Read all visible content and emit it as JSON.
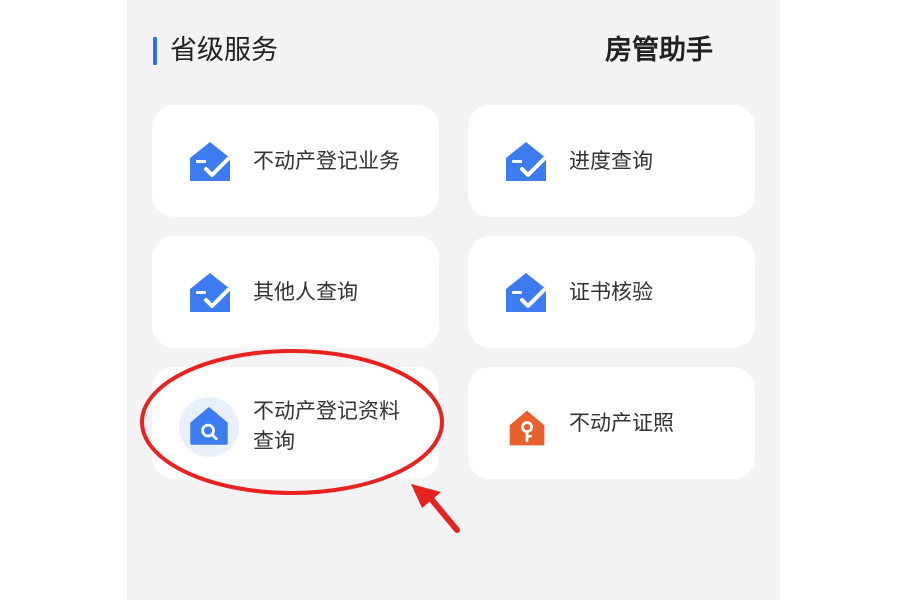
{
  "section": {
    "title": "省级服务",
    "helper": "房管助手"
  },
  "cards": [
    {
      "label": "不动产登记业务",
      "icon": "house-check-icon"
    },
    {
      "label": "进度查询",
      "icon": "house-check-icon"
    },
    {
      "label": "其他人查询",
      "icon": "house-check-icon"
    },
    {
      "label": "证书核验",
      "icon": "house-check-icon"
    },
    {
      "label_line1": "不动产登记资料",
      "label_line2": "查询",
      "icon": "house-search-icon"
    },
    {
      "label": "不动产证照",
      "icon": "house-key-icon"
    }
  ],
  "colors": {
    "accent": "#2f6fe8",
    "annotation": "#e8231f",
    "key_icon": "#e8602c"
  }
}
